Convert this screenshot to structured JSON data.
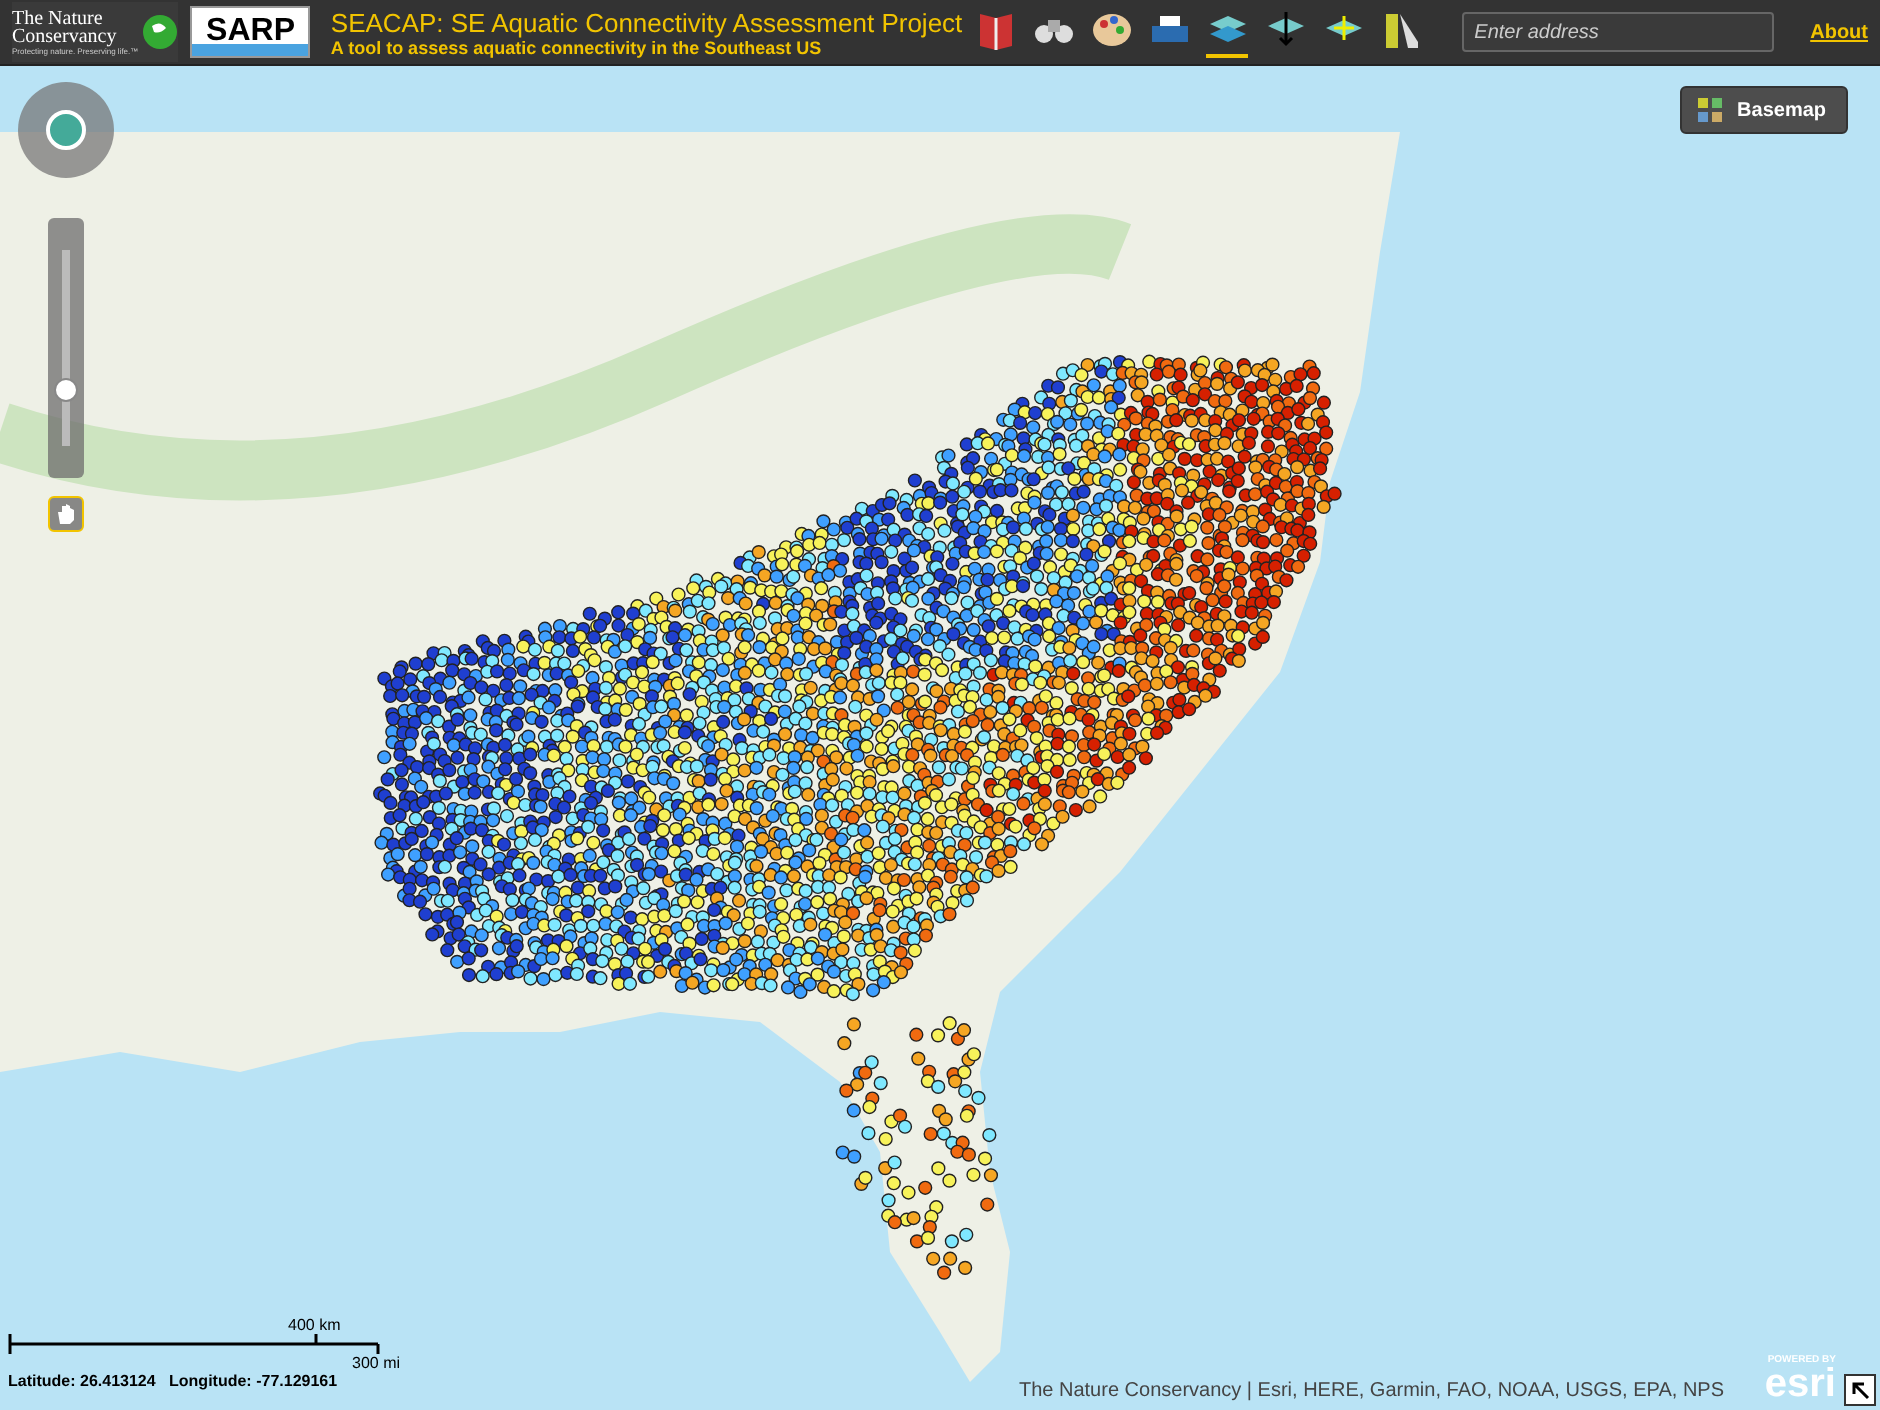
{
  "header": {
    "org_logo": {
      "name": "The Nature Conservancy",
      "tagline": "Protecting nature. Preserving life.™"
    },
    "partner_logo": {
      "name": "SARP"
    },
    "title": "SEACAP: SE Aquatic Connectivity Assessment Project",
    "subtitle": "A tool to assess aquatic connectivity in the Southeast US",
    "tools": [
      {
        "kind": "legend",
        "selected": false
      },
      {
        "kind": "binoculars",
        "selected": false
      },
      {
        "kind": "palette",
        "selected": false
      },
      {
        "kind": "printer",
        "selected": false
      },
      {
        "kind": "layers",
        "selected": true
      },
      {
        "kind": "layer-down",
        "selected": false
      },
      {
        "kind": "layer-add",
        "selected": false
      },
      {
        "kind": "chart",
        "selected": false
      }
    ],
    "search": {
      "placeholder": "Enter address"
    },
    "about_link": "About"
  },
  "map": {
    "basemap_button": "Basemap",
    "zoom_slider": {
      "level": 0.26
    },
    "pan_tool": {
      "selected": true
    },
    "scale_bar": {
      "metric": "400 km",
      "imperial": "300 mi"
    },
    "coordinates": {
      "latitude_label": "Latitude:",
      "latitude": "26.413124",
      "longitude_label": "Longitude:",
      "longitude": "-77.129161"
    },
    "attribution": "The Nature Conservancy | Esri, HERE, Garmin, FAO, NOAA, USGS, EPA, NPS",
    "esri_logo": {
      "caption": "POWERED BY",
      "name": "esri"
    }
  }
}
